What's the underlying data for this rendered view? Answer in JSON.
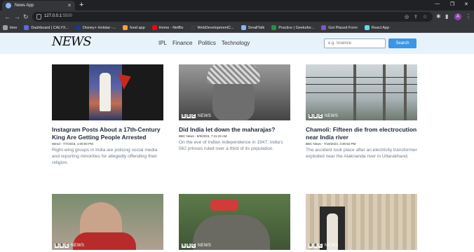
{
  "browser": {
    "tab_title": "News App",
    "new_tab": "+",
    "url_host": "127.0.0.1",
    "url_port": ":5500",
    "bookmarks": [
      {
        "label": "time",
        "color": "#9aa0a6"
      },
      {
        "label": "Dashboard | CALYX...",
        "color": "#5b6bd8"
      },
      {
        "label": "Disney+ Hotstar -...",
        "color": "#1a3a8a"
      },
      {
        "label": "food app",
        "color": "#f2a33a"
      },
      {
        "label": "Home - Netflix",
        "color": "#e50914"
      },
      {
        "label": "WebDevelopmentC...",
        "color": "#3c3c3c"
      },
      {
        "label": "SmallTalk",
        "color": "#8ab4f8"
      },
      {
        "label": "Practice | Geeksfor...",
        "color": "#2f8d46"
      },
      {
        "label": "Got Placed Form",
        "color": "#7e57c2"
      },
      {
        "label": "React App",
        "color": "#61dafb"
      }
    ],
    "avatar_letter": "A"
  },
  "navbar": {
    "brand": "NEWS",
    "links": [
      "IPL",
      "Finance",
      "Politics",
      "Technology"
    ],
    "search_placeholder": "e.g. Science",
    "search_button": "Search"
  },
  "cards": [
    {
      "title": "Instagram Posts About a 17th-Century King Are Getting People Arrested",
      "meta": "Wired - 7/7/2023, 1:00:00 PM",
      "desc": "Right-wing groups in India are policing social media and reporting minorities for allegedly offending their religion.",
      "bbc": false
    },
    {
      "title": "Did India let down the maharajas?",
      "meta": "BBC News - 8/9/2023, 7:41:23 AM",
      "desc": "On the eve of Indian independence in 1947, India's 562 princes ruled over a third of its population.",
      "bbc": true
    },
    {
      "title": "Chamoli: Fifteen die from electrocution near India river",
      "meta": "BBC News - 7/19/2023, 3:30:52 PM",
      "desc": "The accident took place after an electricity transformer exploded near the Alaknanda river in Uttarakhand.",
      "bbc": true
    },
    {
      "title": "",
      "meta": "",
      "desc": "",
      "bbc": true
    },
    {
      "title": "",
      "meta": "",
      "desc": "",
      "bbc": true
    },
    {
      "title": "",
      "meta": "",
      "desc": "",
      "bbc": true
    }
  ],
  "bbc_label": "NEWS",
  "bbc_letters": [
    "B",
    "B",
    "C"
  ]
}
